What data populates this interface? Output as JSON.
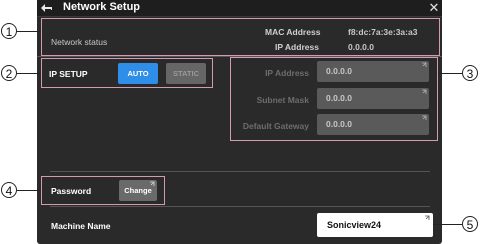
{
  "window": {
    "title": "Network Setup"
  },
  "network_status": {
    "label": "Network status",
    "mac_address_label": "MAC Address",
    "mac_address_value": "f8:dc:7a:3e:3a:a3",
    "ip_address_label": "IP Address",
    "ip_address_value": "0.0.0.0"
  },
  "ip_setup": {
    "label": "IP SETUP",
    "auto_label": "AUTO",
    "static_label": "STATIC",
    "ip_address_label": "IP Address",
    "ip_address_value": "0.0.0.0",
    "subnet_mask_label": "Subnet Mask",
    "subnet_mask_value": "0.0.0.0",
    "default_gateway_label": "Default Gateway",
    "default_gateway_value": "0.0.0.0"
  },
  "password": {
    "label": "Password",
    "change_label": "Change"
  },
  "machine_name": {
    "label": "Machine Name",
    "value": "Sonicview24"
  },
  "callouts": [
    "1",
    "2",
    "3",
    "4",
    "5"
  ],
  "colors": {
    "accent": "#2f8ee8",
    "callout": "#d59ab3",
    "panel": "#2a2a2a"
  }
}
